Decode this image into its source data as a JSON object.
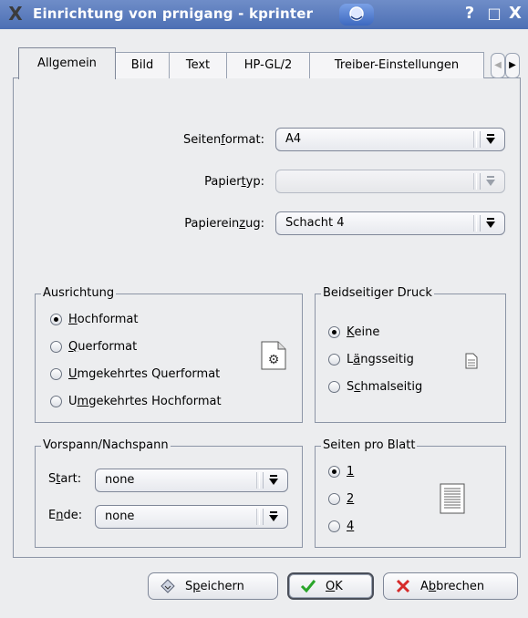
{
  "window": {
    "title": "Einrichtung von prnigang - kprinter",
    "help_glyph": "?",
    "max_glyph": "□",
    "close_glyph": "X",
    "app_glyph": "X"
  },
  "tabs": [
    {
      "label": "Allgemein",
      "active": true
    },
    {
      "label": "Bild",
      "active": false
    },
    {
      "label": "Text",
      "active": false
    },
    {
      "label": "HP-GL/2",
      "active": false
    },
    {
      "label": "Treiber-Einstellungen",
      "active": false
    }
  ],
  "tab_scroll": {
    "left": "◀",
    "right": "▶"
  },
  "form": {
    "seitenformat": {
      "label_pre": "Seiten",
      "label_u": "f",
      "label_post": "ormat:",
      "value": "A4"
    },
    "papiertyp": {
      "label_pre": "Papier",
      "label_u": "t",
      "label_post": "yp:",
      "value": ""
    },
    "papiereinzug": {
      "label_pre": "Papierein",
      "label_u": "z",
      "label_post": "ug:",
      "value": "Schacht 4"
    }
  },
  "ausrichtung": {
    "title": "Ausrichtung",
    "options": [
      {
        "u": "H",
        "rest": "ochformat",
        "pre": "",
        "selected": true
      },
      {
        "u": "Q",
        "rest": "uerformat",
        "pre": "",
        "selected": false
      },
      {
        "u": "U",
        "rest": "mgekehrtes Querformat",
        "pre": "",
        "selected": false
      },
      {
        "pre": "U",
        "u": "m",
        "rest": "gekehrtes Hochformat",
        "selected": false
      }
    ]
  },
  "beidseitig": {
    "title": "Beidseitiger Druck",
    "options": [
      {
        "pre": "",
        "u": "K",
        "rest": "eine",
        "selected": true
      },
      {
        "pre": "L",
        "u": "ä",
        "rest": "ngsseitig",
        "selected": false
      },
      {
        "pre": "S",
        "u": "c",
        "rest": "hmalseitig",
        "selected": false
      }
    ]
  },
  "vorspann": {
    "title": "Vorspann/Nachspann",
    "start": {
      "pre": "S",
      "u": "t",
      "post": "art:",
      "value": "none"
    },
    "ende": {
      "pre": "E",
      "u": "n",
      "post": "de:",
      "value": "none"
    }
  },
  "seiten_pro_blatt": {
    "title": "Seiten pro Blatt",
    "options": [
      {
        "u": "1",
        "selected": true
      },
      {
        "u": "2",
        "selected": false
      },
      {
        "u": "4",
        "selected": false
      }
    ]
  },
  "buttons": {
    "save": {
      "pre": "S",
      "u": "p",
      "post": "eichern"
    },
    "ok": {
      "pre": "",
      "u": "O",
      "post": "K"
    },
    "cancel": {
      "pre": "A",
      "u": "b",
      "post": "brechen"
    }
  },
  "colors": {
    "titlebar": "#4c6fb4",
    "ok_check": "#2aa52a",
    "cancel_x": "#d62a2a"
  }
}
